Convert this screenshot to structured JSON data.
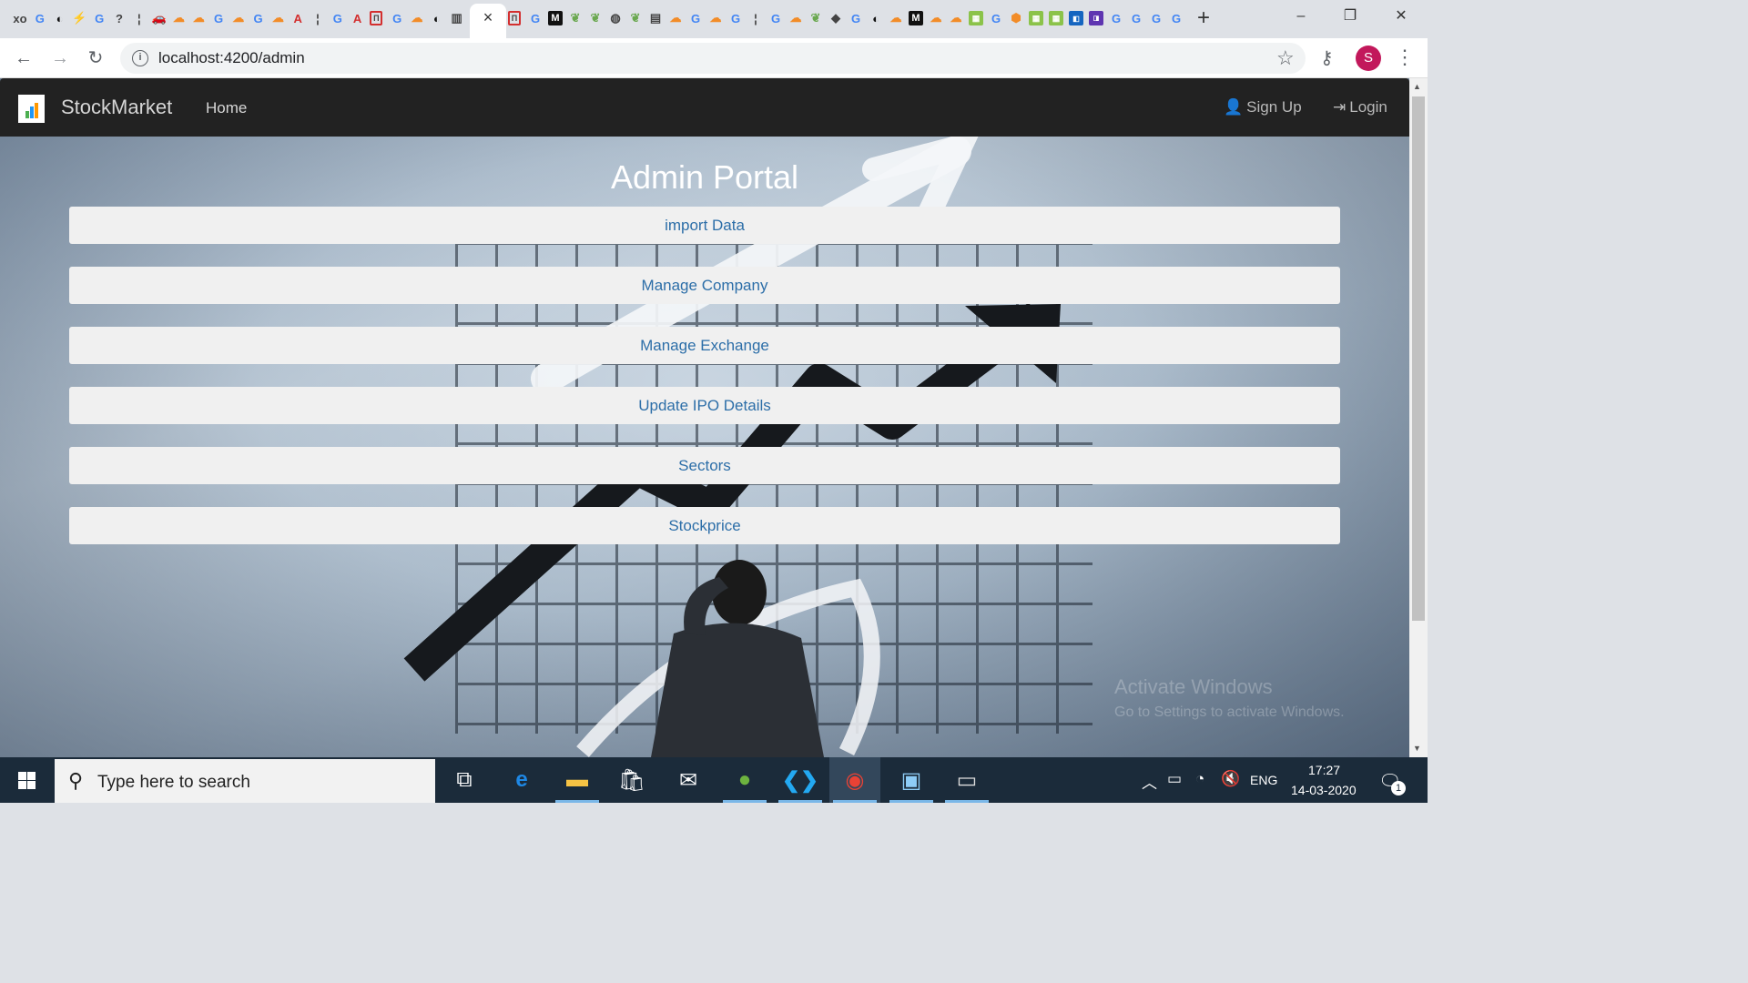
{
  "browser": {
    "tab_favicons": [
      "xo",
      "G",
      "gh",
      "⚡",
      "G",
      "?",
      "¦",
      "car",
      "sf",
      "sf",
      "G",
      "sf",
      "G",
      "sf",
      "A",
      "¦",
      "G",
      "A",
      "П",
      "G",
      "sf",
      "gh",
      "|||"
    ],
    "tab_favicons_right": [
      "П",
      "G",
      "M",
      "leaf",
      "leaf",
      "globe",
      "leaf",
      "book",
      "sf",
      "G",
      "sf",
      "G",
      "¦",
      "G",
      "sf",
      "leaf",
      "shield",
      "G",
      "gh",
      "sf",
      "M",
      "sf",
      "sf",
      "gr",
      "G",
      "or",
      "gr",
      "gr",
      "bl",
      "pu",
      "G",
      "G",
      "G",
      "G"
    ],
    "active_tab_close": "×",
    "new_tab": "+",
    "window_controls": {
      "minimize": "–",
      "restore": "❐",
      "close": "✕"
    },
    "url": "localhost:4200/admin",
    "profile_initial": "S"
  },
  "navbar": {
    "brand": "StockMarket",
    "home": "Home",
    "signup": "Sign Up",
    "login": "Login"
  },
  "page": {
    "title": "Admin Portal",
    "actions": [
      "import Data",
      "Manage Company",
      "Manage Exchange",
      "Update IPO Details",
      "Sectors",
      "Stockprice"
    ],
    "watermark_title": "Activate Windows",
    "watermark_sub": "Go to Settings to activate Windows."
  },
  "taskbar": {
    "search_placeholder": "Type here to search",
    "language": "ENG",
    "time": "17:27",
    "date": "14-03-2020",
    "notification_count": "1"
  },
  "colors": {
    "navbar_bg": "#222222",
    "button_bg": "#f0f0f0",
    "button_text": "#2c6ea8",
    "taskbar_bg": "#1b2b3a",
    "avatar_bg": "#c2185b"
  }
}
